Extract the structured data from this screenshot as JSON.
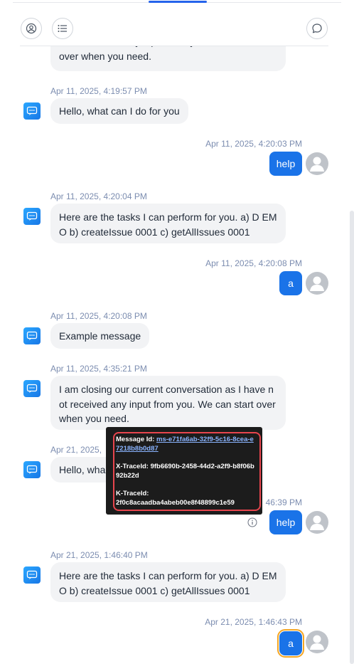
{
  "toolbar": {
    "profile_icon": "user-circle-icon",
    "list_icon": "list-icon",
    "chat_icon": "chat-bubble-icon"
  },
  "messages": [
    {
      "sender": "bot",
      "text": "e not received any input from you. We can sta rt over when you need.",
      "partial": true
    },
    {
      "sender": "bot",
      "time": "Apr 11, 2025, 4:19:57 PM",
      "text": "Hello, what can I do for you"
    },
    {
      "sender": "user",
      "time": "Apr 11, 2025, 4:20:03 PM",
      "text": "help"
    },
    {
      "sender": "bot",
      "time": "Apr 11, 2025, 4:20:04 PM",
      "text": "Here are the tasks I can perform for you. a) D EMO b) createIssue 0001 c) getAllIssues 0001"
    },
    {
      "sender": "user",
      "time": "Apr 11, 2025, 4:20:08 PM",
      "text": "a"
    },
    {
      "sender": "bot",
      "time": "Apr 11, 2025, 4:20:08 PM",
      "text": "Example message"
    },
    {
      "sender": "bot",
      "time": "Apr 11, 2025, 4:35:21 PM",
      "text": "I am closing our current conversation as I have not received any input from you. We can start over when you need."
    },
    {
      "sender": "bot",
      "time": "Apr 21, 2025,",
      "text": "Hello, wha"
    },
    {
      "sender": "user",
      "time": "46:39 PM",
      "text": "help"
    },
    {
      "sender": "bot",
      "time": "Apr 21, 2025, 1:46:40 PM",
      "text": "Here are the tasks I can perform for you. a) D EMO b) createIssue 0001 c) getAllIssues 0001"
    },
    {
      "sender": "user",
      "time": "Apr 21, 2025, 1:46:43 PM",
      "text": "a"
    }
  ],
  "tooltip": {
    "message_id_label": "Message Id:",
    "message_id_value": "ms-e71fa6ab-32f9-5c16-8cea-e7218b8b0d87",
    "xtrace_label": "X-TraceId:",
    "xtrace_value": "9fb6690b-2458-44d2-a2f9-b8f06b92b22d",
    "ktrace_label": "K-TraceId:",
    "ktrace_value": "2f0c8acaadba4abeb00e8f48899c1e59"
  },
  "colors": {
    "user_bubble": "#1a73e8",
    "bot_bubble": "#f2f3f5",
    "timestamp": "#7c8db0",
    "highlight": "#e8454d",
    "focus": "#f5a623"
  }
}
